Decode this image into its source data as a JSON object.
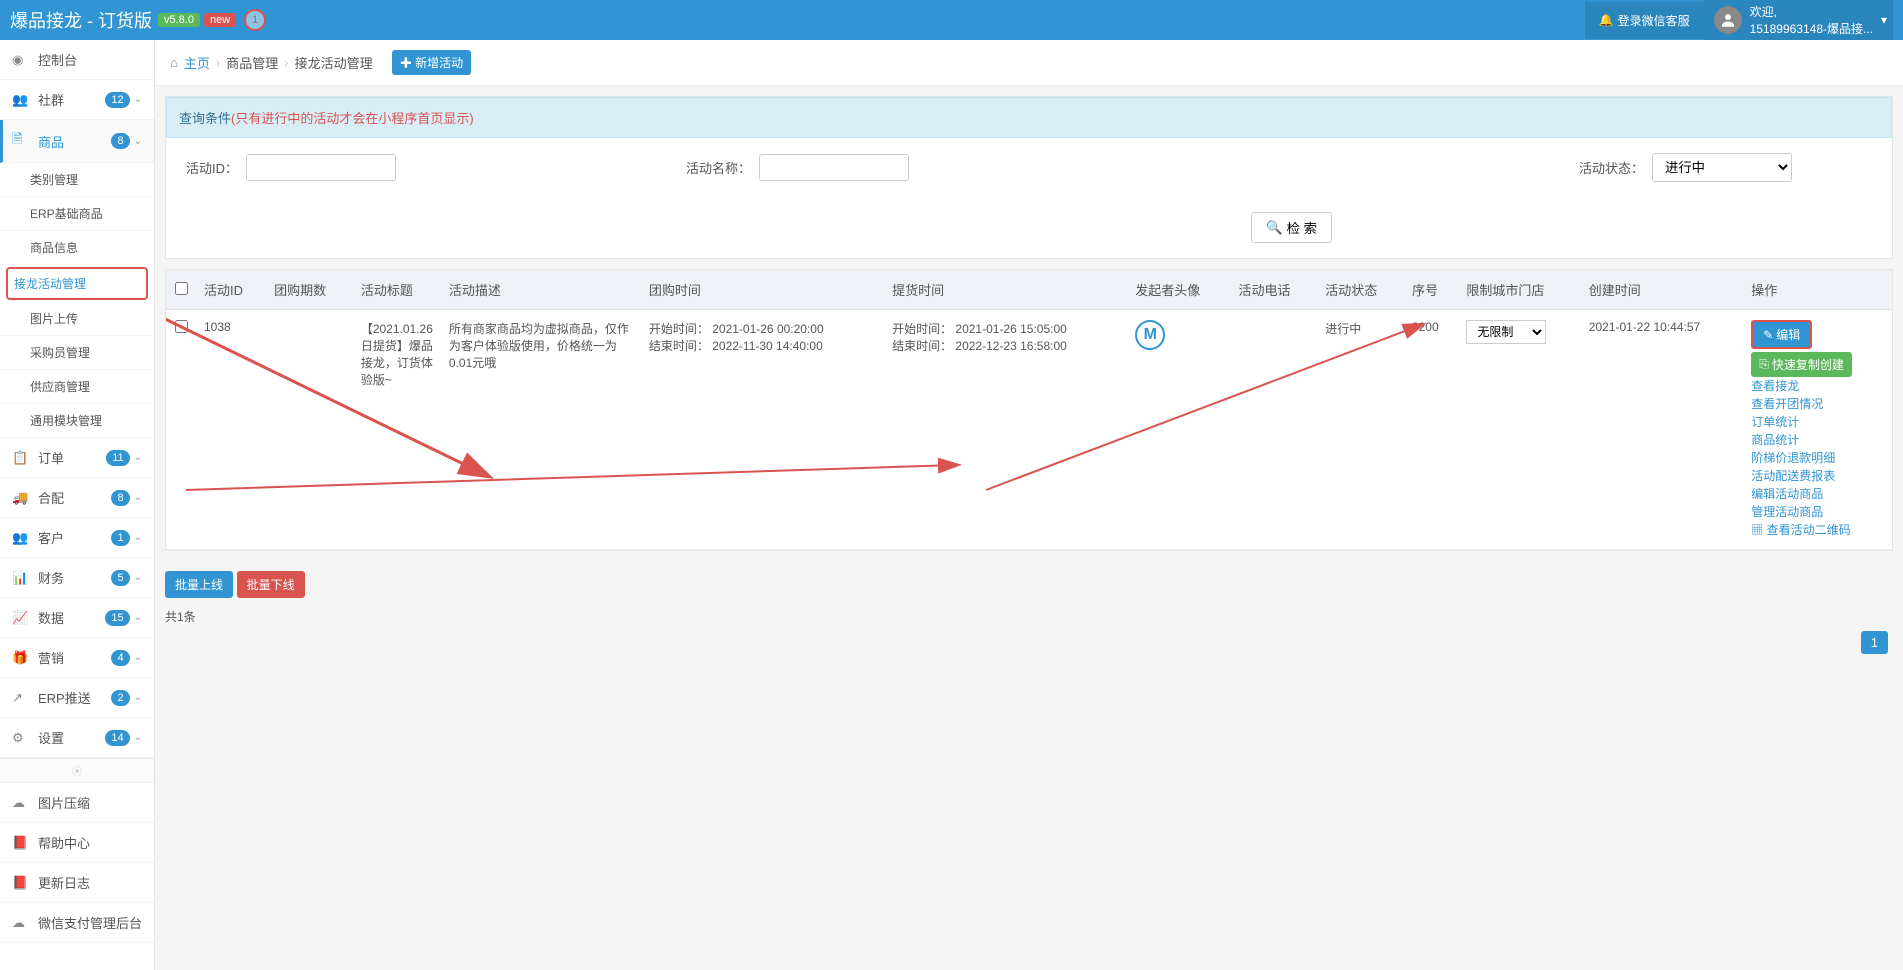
{
  "header": {
    "title": "爆品接龙 - 订货版",
    "version": "v5.8.0",
    "new_label": "new",
    "circle_label": "1",
    "wx_login": "登录微信客服",
    "welcome": "欢迎,",
    "username": "15189963148-爆品接..."
  },
  "sidebar": {
    "items": [
      {
        "icon": "dashboard",
        "label": "控制台"
      },
      {
        "icon": "users",
        "label": "社群",
        "badge": "12"
      },
      {
        "icon": "file",
        "label": "商品",
        "badge": "8",
        "active": true
      },
      {
        "icon": "list",
        "label": "订单",
        "badge": "11"
      },
      {
        "icon": "truck",
        "label": "合配",
        "badge": "8"
      },
      {
        "icon": "user-group",
        "label": "客户",
        "badge": "1"
      },
      {
        "icon": "chart",
        "label": "财务",
        "badge": "5"
      },
      {
        "icon": "stats",
        "label": "数据",
        "badge": "15"
      },
      {
        "icon": "gift",
        "label": "营销",
        "badge": "4"
      },
      {
        "icon": "share",
        "label": "ERP推送",
        "badge": "2"
      },
      {
        "icon": "gear",
        "label": "设置",
        "badge": "14"
      }
    ],
    "subs": [
      "类别管理",
      "ERP基础商品",
      "商品信息",
      "接龙活动管理",
      "图片上传",
      "采购员管理",
      "供应商管理",
      "通用模块管理"
    ],
    "bottom": [
      "图片压缩",
      "帮助中心",
      "更新日志",
      "微信支付管理后台"
    ]
  },
  "breadcrumb": {
    "home": "主页",
    "level1": "商品管理",
    "level2": "接龙活动管理",
    "add_btn": "新增活动"
  },
  "alert": {
    "prefix": "查询条件",
    "red_text": "(只有进行中的活动才会在小程序首页显示)"
  },
  "search": {
    "id_label": "活动ID：",
    "name_label": "活动名称：",
    "status_label": "活动状态：",
    "status_value": "进行中",
    "search_btn": "检 索"
  },
  "table": {
    "headers": [
      "活动ID",
      "团购期数",
      "活动标题",
      "活动描述",
      "团购时间",
      "提货时间",
      "发起者头像",
      "活动电话",
      "活动状态",
      "序号",
      "限制城市门店",
      "创建时间",
      "操作"
    ],
    "row": {
      "id": "1038",
      "period": "",
      "title": "【2021.01.26日提货】爆品接龙，订货体验版~",
      "desc": "所有商家商品均为虚拟商品，仅作为客户体验版使用，价格统一为0.01元哦",
      "group_start": "开始时间： 2021-01-26 00:20:00",
      "group_end": "结束时间： 2022-11-30 14:40:00",
      "pickup_start": "开始时间： 2021-01-26 15:05:00",
      "pickup_end": "结束时间： 2022-12-23 16:58:00",
      "avatar_letter": "M",
      "phone": "",
      "status": "进行中",
      "seq": "3200",
      "limit_option": "无限制",
      "created": "2021-01-22 10:44:57"
    },
    "actions": {
      "edit": "编辑",
      "copy": "快速复制创建",
      "links": [
        "查看接龙",
        "查看开团情况",
        "订单统计",
        "商品统计",
        "阶梯价退款明细",
        "活动配送费报表",
        "编辑活动商品",
        "管理活动商品",
        "查看活动二维码"
      ]
    }
  },
  "footer": {
    "batch_on": "批量上线",
    "batch_off": "批量下线",
    "total": "共1条",
    "page": "1"
  }
}
